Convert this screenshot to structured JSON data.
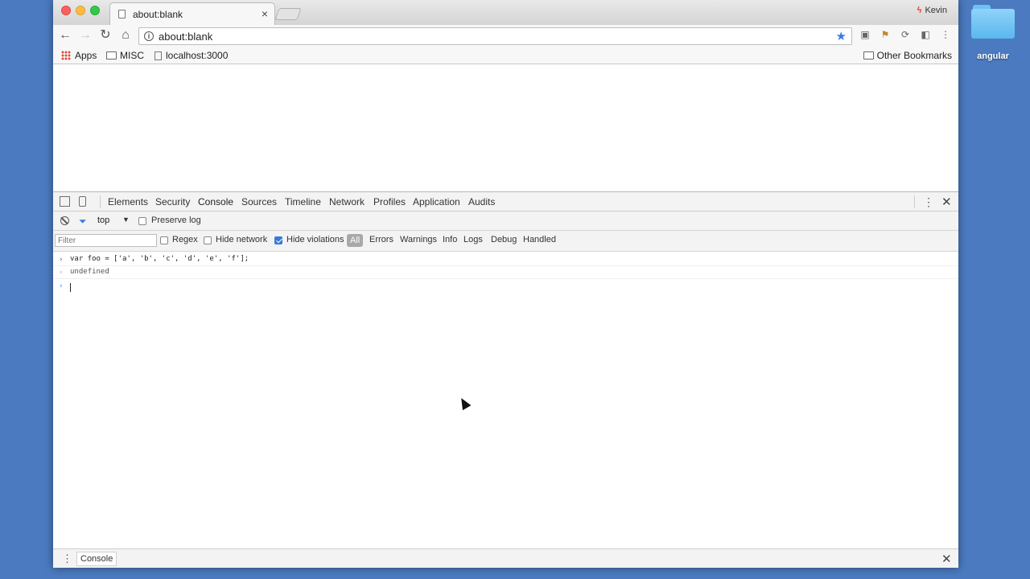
{
  "desktop": {
    "folder_label": "angular"
  },
  "browser": {
    "tab_title": "about:blank",
    "tab_close": "×",
    "profile_name": "Kevin",
    "profile_icon": "ϟ",
    "url": "about:blank",
    "nav": {
      "back": "←",
      "forward": "→",
      "reload": "↻",
      "home": "⌂"
    },
    "star": "★",
    "menu": "⋮",
    "bookmarks": [
      {
        "label": "Apps"
      },
      {
        "label": "MISC"
      },
      {
        "label": "localhost:3000"
      }
    ],
    "other_bookmarks": "Other Bookmarks"
  },
  "devtools": {
    "tabs": [
      "Elements",
      "Security",
      "Console",
      "Sources",
      "Timeline",
      "Network",
      "Profiles",
      "Application",
      "Audits"
    ],
    "active_tab": "Console",
    "context": "top",
    "preserve_log": "Preserve log",
    "filter_placeholder": "Filter",
    "regex": "Regex",
    "hide_network": "Hide network",
    "hide_violations": "Hide violations",
    "levels": {
      "all": "All",
      "items": [
        "Errors",
        "Warnings",
        "Info",
        "Logs",
        "Debug",
        "Handled"
      ]
    },
    "console_lines": [
      {
        "kind": "input",
        "prompt": "›",
        "text": "var foo = ['a', 'b', 'c', 'd', 'e', 'f'];"
      },
      {
        "kind": "output",
        "prompt": "‹",
        "text": "undefined"
      }
    ],
    "cursor_prompt": "›",
    "drawer_tab": "Console",
    "close": "✕",
    "more": "⋮"
  }
}
